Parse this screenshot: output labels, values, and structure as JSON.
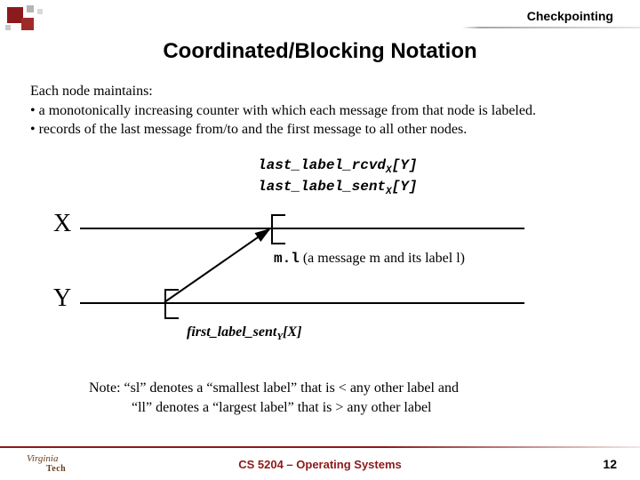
{
  "header": {
    "corner": "Checkpointing",
    "title": "Coordinated/Blocking Notation"
  },
  "body": {
    "intro": "Each node maintains:",
    "b1": "• a monotonically increasing counter with which each message from that node is labeled.",
    "b2": "• records of the last message from/to and the first message to all other nodes."
  },
  "code": {
    "line1a": "last_label_rcvd",
    "line1sub": "X",
    "line1b": "[Y]",
    "line2a": "last_label_sent",
    "line2sub": "X",
    "line2b": "[Y]"
  },
  "diagram": {
    "X": "X",
    "Y": "Y",
    "msg_ml": "m.l",
    "msg_rest": " (a message m and its label l)",
    "first_a": "first_label_sent",
    "first_sub": "Y",
    "first_b": "[X]"
  },
  "note": {
    "l1": "Note:  “sl” denotes a “smallest label” that is < any other label and",
    "l2": "“ll” denotes a “largest label” that is > any other label"
  },
  "footer": {
    "logo1": "Virginia",
    "logo2": "Tech",
    "center": "CS 5204 – Operating Systems",
    "page": "12"
  }
}
